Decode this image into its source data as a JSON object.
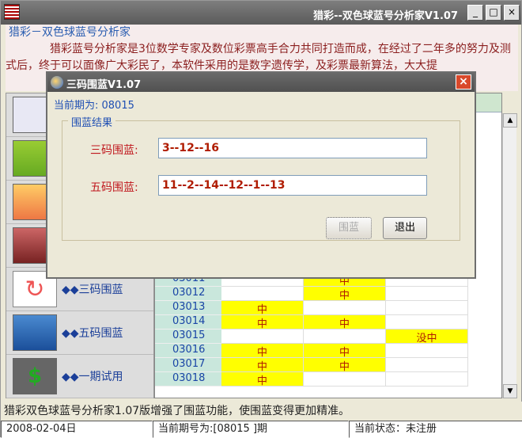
{
  "window": {
    "title": "猎彩--双色球蓝号分析家V1.07",
    "min_label": "_",
    "max_label": "□",
    "close_label": "×"
  },
  "intro": {
    "heading": "猎彩－双色球蓝号分析家",
    "text": "猎彩蓝号分析家是3位数学专家及数位彩票高手合力共同打造而成，在经过了二年多的努力及测式后，终于可以面像广大彩民了，本软件采用的是数字遗传学，及彩票最新算法，大大提"
  },
  "sidebar": {
    "items": [
      {
        "icon": "pencil-icon",
        "label": ""
      },
      {
        "icon": "image-icon",
        "label": ""
      },
      {
        "icon": "flower-icon",
        "label": ""
      },
      {
        "icon": "photo-icon",
        "label": ""
      },
      {
        "icon": "refresh-icon",
        "label": "◆◆三码围蓝"
      },
      {
        "icon": "chart-icon",
        "label": "◆◆五码围蓝"
      },
      {
        "icon": "money-bag-icon",
        "label": "◆◆一期试用"
      }
    ]
  },
  "table": {
    "rows": [
      {
        "issue": "03011",
        "cells": [
          "",
          "中",
          ""
        ]
      },
      {
        "issue": "03012",
        "cells": [
          "",
          "中",
          ""
        ]
      },
      {
        "issue": "03013",
        "cells": [
          "中",
          "",
          ""
        ]
      },
      {
        "issue": "03014",
        "cells": [
          "中",
          "中",
          ""
        ]
      },
      {
        "issue": "03015",
        "cells": [
          "",
          "",
          "没中"
        ]
      },
      {
        "issue": "03016",
        "cells": [
          "中",
          "中",
          ""
        ]
      },
      {
        "issue": "03017",
        "cells": [
          "中",
          "中",
          ""
        ]
      },
      {
        "issue": "03018",
        "cells": [
          "中",
          "",
          ""
        ]
      }
    ]
  },
  "status_message": "猎彩双色球蓝号分析家1.07版增强了围蓝功能，使围蓝变得更加精准。",
  "statusbar": {
    "date": "2008-02-04日",
    "current_issue": "当前期号为:[08015 ]期",
    "state": "当前状态：未注册"
  },
  "dialog": {
    "title": "三码围蓝V1.07",
    "current_period": "当前期为: 08015",
    "group_label": "围蓝结果",
    "three_label": "三码围蓝:",
    "three_value": "3--12--16",
    "five_label": "五码围蓝:",
    "five_value": "11--2--14--12--1--13",
    "calc_button": "围蓝",
    "exit_button": "退出",
    "close_label": "×"
  }
}
